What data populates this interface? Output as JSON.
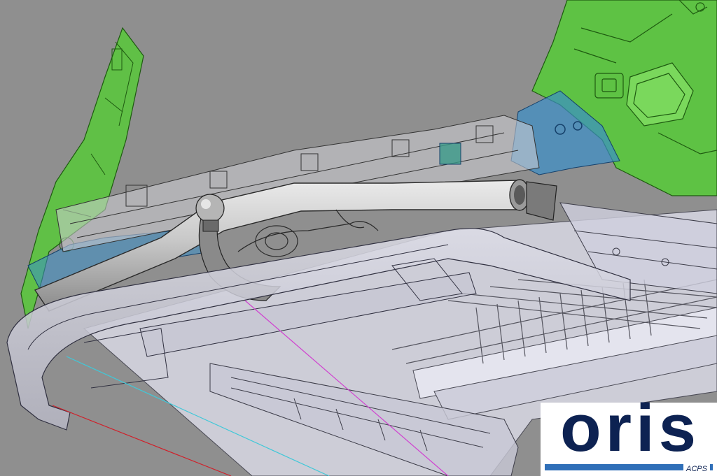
{
  "logo": {
    "wordmark": "oris",
    "subtitle": "ACPS",
    "color": "#0d2252",
    "bar_color": "#2f6fb8"
  },
  "colors": {
    "background": "#8f8f8f",
    "body_panels_green": "#58c93a",
    "reinforcement_blue": "#3a8fc8",
    "tow_bar_grey": "#c7c7c7",
    "chassis_lavender": "#d6d6e2",
    "construction_line_red": "#d0202a",
    "construction_line_cyan": "#40c8d8",
    "construction_line_magenta": "#d040d0"
  }
}
